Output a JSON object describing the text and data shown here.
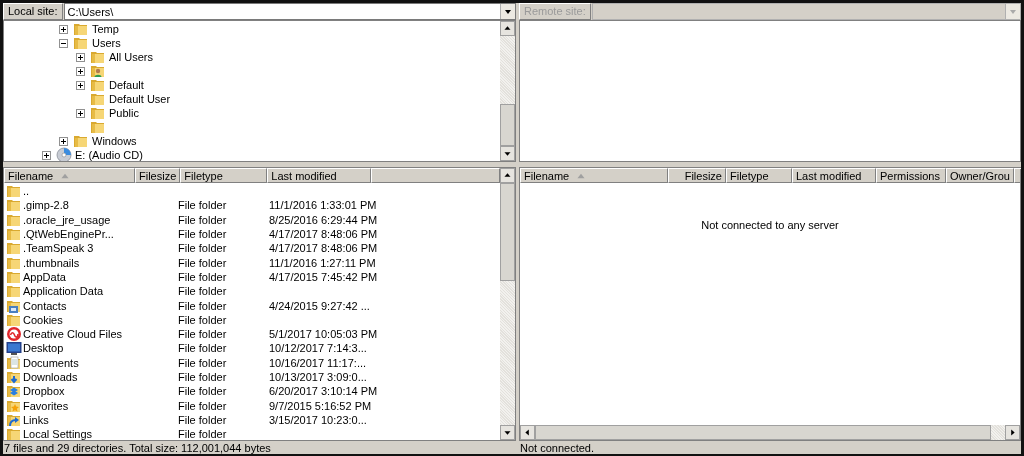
{
  "local": {
    "site_label": "Local site:",
    "path": "C:\\Users\\",
    "tree": [
      {
        "kind": "parent",
        "children": [
          {
            "label": "Temp",
            "kind": "folder",
            "expandable": true,
            "expanded": false
          },
          {
            "label": "Users",
            "kind": "folder",
            "expandable": true,
            "expanded": true,
            "children": [
              {
                "label": "All Users",
                "kind": "folder",
                "expandable": true,
                "expanded": false
              },
              {
                "kind": "user",
                "expandable": true,
                "expanded": false
              },
              {
                "label": "Default",
                "kind": "folder",
                "expandable": true,
                "expanded": false
              },
              {
                "label": "Default User",
                "kind": "folder",
                "expandable": false,
                "expanded": false
              },
              {
                "label": "Public",
                "kind": "folder",
                "expandable": true,
                "expanded": false
              },
              {
                "kind": "folder",
                "expandable": false,
                "expanded": false
              }
            ]
          },
          {
            "label": "Windows",
            "kind": "folder",
            "expandable": true,
            "expanded": false
          }
        ]
      },
      {
        "label": "E: (Audio CD)",
        "kind": "cd",
        "expandable": true,
        "expanded": false
      }
    ],
    "columns": [
      {
        "label": "Filename",
        "sorted": true
      },
      {
        "label": "Filesize",
        "sorted": false
      },
      {
        "label": "Filetype",
        "sorted": false
      },
      {
        "label": "Last modified",
        "sorted": false
      }
    ],
    "rows": [
      {
        "kind": "folder",
        "name": ".."
      },
      {
        "kind": "folder",
        "name": ".gimp-2.8",
        "type": "File folder",
        "modified": "11/1/2016 1:33:01 PM"
      },
      {
        "kind": "folder",
        "name": ".oracle_jre_usage",
        "type": "File folder",
        "modified": "8/25/2016 6:29:44 PM"
      },
      {
        "kind": "folder",
        "name": ".QtWebEnginePr...",
        "type": "File folder",
        "modified": "4/17/2017 8:48:06 PM"
      },
      {
        "kind": "folder",
        "name": ".TeamSpeak 3",
        "type": "File folder",
        "modified": "4/17/2017 8:48:06 PM"
      },
      {
        "kind": "folder",
        "name": ".thumbnails",
        "type": "File folder",
        "modified": "11/1/2016 1:27:11 PM"
      },
      {
        "kind": "folder",
        "name": "AppData",
        "type": "File folder",
        "modified": "4/17/2015 7:45:42 PM"
      },
      {
        "kind": "folder",
        "name": "Application Data",
        "type": "File folder"
      },
      {
        "kind": "contacts",
        "name": "Contacts",
        "type": "File folder",
        "modified": "4/24/2015 9:27:42 ..."
      },
      {
        "kind": "folder",
        "name": "Cookies",
        "type": "File folder"
      },
      {
        "kind": "cloud",
        "name": "Creative Cloud Files",
        "type": "File folder",
        "modified": "5/1/2017 10:05:03 PM"
      },
      {
        "kind": "desktop",
        "name": "Desktop",
        "type": "File folder",
        "modified": "10/12/2017 7:14:3..."
      },
      {
        "kind": "documents",
        "name": "Documents",
        "type": "File folder",
        "modified": "10/16/2017 11:17:..."
      },
      {
        "kind": "downloads",
        "name": "Downloads",
        "type": "File folder",
        "modified": "10/13/2017 3:09:0..."
      },
      {
        "kind": "dropbox",
        "name": "Dropbox",
        "type": "File folder",
        "modified": "6/20/2017 3:10:14 PM"
      },
      {
        "kind": "favorites",
        "name": "Favorites",
        "type": "File folder",
        "modified": "9/7/2015 5:16:52 PM"
      },
      {
        "kind": "links",
        "name": "Links",
        "type": "File folder",
        "modified": "3/15/2017 10:23:0..."
      },
      {
        "kind": "folder",
        "name": "Local Settings",
        "type": "File folder"
      }
    ],
    "status": "7 files and 29 directories. Total size: 112,001,044 bytes"
  },
  "remote": {
    "site_label": "Remote site:",
    "disabled": true,
    "columns": [
      {
        "label": "Filename",
        "sorted": true
      },
      {
        "label": "Filesize",
        "sorted": false
      },
      {
        "label": "Filetype",
        "sorted": false
      },
      {
        "label": "Last modified",
        "sorted": false
      },
      {
        "label": "Permissions",
        "sorted": false
      },
      {
        "label": "Owner/Grou",
        "sorted": false
      }
    ],
    "message": "Not connected to any server",
    "status": "Not connected."
  }
}
